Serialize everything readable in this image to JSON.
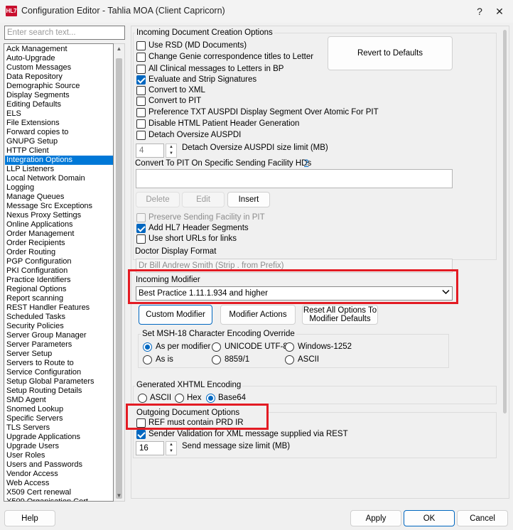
{
  "window": {
    "icon_text": "HL7",
    "title": "Configuration Editor - Tahlia MOA (Client Capricorn)",
    "help_glyph": "?",
    "close_glyph": "✕"
  },
  "search": {
    "placeholder": "Enter search text..."
  },
  "sidebar": {
    "selected": "Integration Options",
    "items": [
      "Ack Management",
      "Auto-Upgrade",
      "Custom Messages",
      "Data Repository",
      "Demographic Source",
      "Display Segments",
      "Editing Defaults",
      "ELS",
      "File Extensions",
      "Forward copies to",
      "GNUPG Setup",
      "HTTP Client",
      "Integration Options",
      "LLP Listeners",
      "Local Network Domain",
      "Logging",
      "Manage Queues",
      "Message Src Exceptions",
      "Nexus Proxy Settings",
      "Online Applications",
      "Order Management",
      "Order Recipients",
      "Order Routing",
      "PGP Configuration",
      "PKI Configuration",
      "Practice Identifiers",
      "Regional Options",
      "Report scanning",
      "REST Handler Features",
      "Scheduled Tasks",
      "Security Policies",
      "Server Group Manager",
      "Server Parameters",
      "Server Setup",
      "Servers to Route to",
      "Service Configuration",
      "Setup Global Parameters",
      "Setup Routing Details",
      "SMD Agent",
      "Snomed Lookup",
      "Specific Servers",
      "TLS Servers",
      "Upgrade Applications",
      "Upgrade Users",
      "User Roles",
      "Users and Passwords",
      "Vendor Access",
      "Web Access",
      "X509 Cert renewal",
      "X509 Organisation Cert"
    ]
  },
  "incoming": {
    "title": "Incoming Document Creation Options",
    "revert_label": "Revert to Defaults",
    "options": [
      {
        "label": "Use RSD (MD Documents)",
        "checked": false
      },
      {
        "label": "Change Genie correspondence titles to Letter",
        "checked": false
      },
      {
        "label": "All Clinical messages to Letters in BP",
        "checked": false
      },
      {
        "label": "Evaluate and Strip Signatures",
        "checked": true
      },
      {
        "label": "Convert to XML",
        "checked": false
      },
      {
        "label": "Convert to PIT",
        "checked": false
      },
      {
        "label": "Preference TXT AUSPDI Display Segment Over Atomic For PIT",
        "checked": false
      },
      {
        "label": "Disable HTML Patient Header Generation",
        "checked": false
      },
      {
        "label": "Detach Oversize AUSPDI",
        "checked": false
      }
    ],
    "size_limit_value": "4",
    "size_limit_label": "Detach Oversize AUSPDI size limit (MB)",
    "pit_facility_label": "Convert To PIT On Specific Sending Facility HDs",
    "pit_help": "?",
    "delete_label": "Delete",
    "edit_label": "Edit",
    "insert_label": "Insert",
    "preserve_label": "Preserve Sending Facility in PIT",
    "hl7_header_label": "Add HL7 Header Segments",
    "short_urls_label": "Use short URLs for links",
    "doctor_format_label": "Doctor Display Format",
    "doctor_format_value": "Dr Bill Andrew Smith (Strip . from Prefix)",
    "modifier_label": "Incoming Modifier",
    "modifier_value": "Best Practice 1.11.1.934 and higher",
    "custom_modifier_label": "Custom Modifier",
    "modifier_actions_label": "Modifier Actions",
    "reset_line1": "Reset All Options To",
    "reset_line2": "Modifier Defaults"
  },
  "encoding": {
    "title": "Set MSH-18 Character Encoding Override",
    "options": [
      {
        "label": "As per modifier",
        "selected": true
      },
      {
        "label": "UNICODE UTF-8",
        "selected": false
      },
      {
        "label": "Windows-1252",
        "selected": false
      },
      {
        "label": "As is",
        "selected": false
      },
      {
        "label": "8859/1",
        "selected": false
      },
      {
        "label": "ASCII",
        "selected": false
      }
    ]
  },
  "xhtml": {
    "title": "Generated XHTML Encoding",
    "options": [
      {
        "label": "ASCII",
        "selected": false
      },
      {
        "label": "Hex",
        "selected": false
      },
      {
        "label": "Base64",
        "selected": true
      }
    ]
  },
  "outgoing": {
    "title": "Outgoing Document Options",
    "ref_label": "REF must contain PRD IR",
    "sender_label": "Sender Validation for XML message supplied via REST",
    "send_limit_value": "16",
    "send_limit_label": "Send message size limit (MB)"
  },
  "footer": {
    "help": "Help",
    "apply": "Apply",
    "ok": "OK",
    "cancel": "Cancel"
  },
  "colors": {
    "accent": "#0067c0",
    "selection": "#0078d7",
    "highlight_box": "#e31b23"
  },
  "icons": {
    "spin_up": "▲",
    "spin_down": "▼",
    "dropdown": "chevron-down-icon"
  }
}
